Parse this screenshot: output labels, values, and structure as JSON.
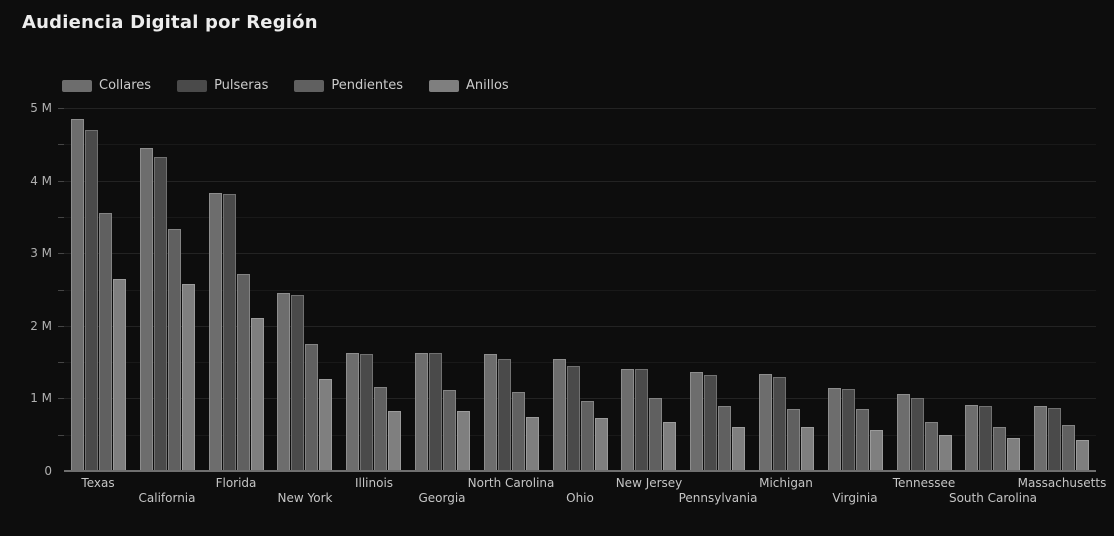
{
  "title": "Audiencia Digital por Región",
  "colors": {
    "background": "#0d0d0d",
    "title_text": "#ededed",
    "legend_text": "#cccccc",
    "axis_line": "#6f6f6f",
    "y_label_text": "#b0b0b0",
    "x_label_text": "#c5c5c5",
    "gridline_major": "#232323",
    "gridline_minor": "#191919"
  },
  "chart_data": {
    "type": "bar",
    "title": "Audiencia Digital por Región",
    "unit": "millions",
    "ylim": [
      0,
      5
    ],
    "y_tick_labels": [
      "0",
      "1 M",
      "2 M",
      "3 M",
      "4 M",
      "5 M"
    ],
    "grid": "horizontal gridlines every 0.5M, minor + major",
    "legend_position": "top-left",
    "legend": [
      "Collares",
      "Pulseras",
      "Pendientes",
      "Anillos"
    ],
    "categories": [
      "Texas",
      "California",
      "Florida",
      "New York",
      "Illinois",
      "Georgia",
      "North Carolina",
      "Ohio",
      "New Jersey",
      "Pennsylvania",
      "Michigan",
      "Virginia",
      "Tennessee",
      "South Carolina",
      "Massachusetts"
    ],
    "x_label_layout": "staggered two rows (even index upper row, odd index lower row)",
    "series": [
      {
        "name": "Collares",
        "color": "#6d6d6d",
        "values": [
          4.85,
          4.45,
          3.83,
          2.45,
          1.63,
          1.63,
          1.61,
          1.54,
          1.4,
          1.36,
          1.33,
          1.15,
          1.06,
          0.91,
          0.9
        ]
      },
      {
        "name": "Pulseras",
        "color": "#4a4a4a",
        "values": [
          4.7,
          4.33,
          3.82,
          2.42,
          1.61,
          1.63,
          1.54,
          1.45,
          1.41,
          1.32,
          1.29,
          1.13,
          1.01,
          0.9,
          0.87
        ]
      },
      {
        "name": "Pendientes",
        "color": "#606060",
        "values": [
          3.55,
          3.34,
          2.72,
          1.75,
          1.16,
          1.12,
          1.09,
          0.97,
          1.0,
          0.9,
          0.86,
          0.85,
          0.68,
          0.6,
          0.63
        ]
      },
      {
        "name": "Anillos",
        "color": "#7f7f7f",
        "values": [
          2.65,
          2.57,
          2.11,
          1.27,
          0.83,
          0.82,
          0.75,
          0.73,
          0.68,
          0.6,
          0.61,
          0.56,
          0.5,
          0.45,
          0.43
        ]
      }
    ]
  }
}
